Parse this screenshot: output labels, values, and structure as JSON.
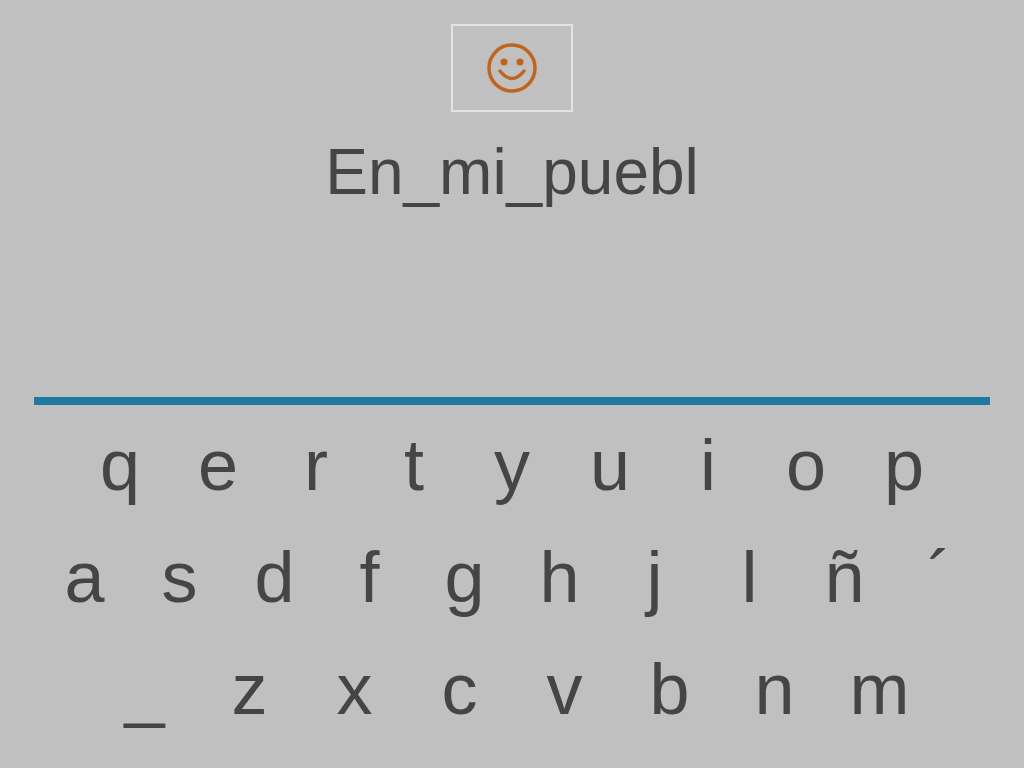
{
  "word": "En_mi_puebl",
  "keyboard": {
    "rows": [
      [
        "q",
        "e",
        "r",
        "t",
        "y",
        "u",
        "i",
        "o",
        "p"
      ],
      [
        "a",
        "s",
        "d",
        "f",
        "g",
        "h",
        "j",
        "l",
        "ñ",
        "´"
      ],
      [
        "_",
        "z",
        "x",
        "c",
        "v",
        "b",
        "n",
        "m"
      ]
    ]
  }
}
